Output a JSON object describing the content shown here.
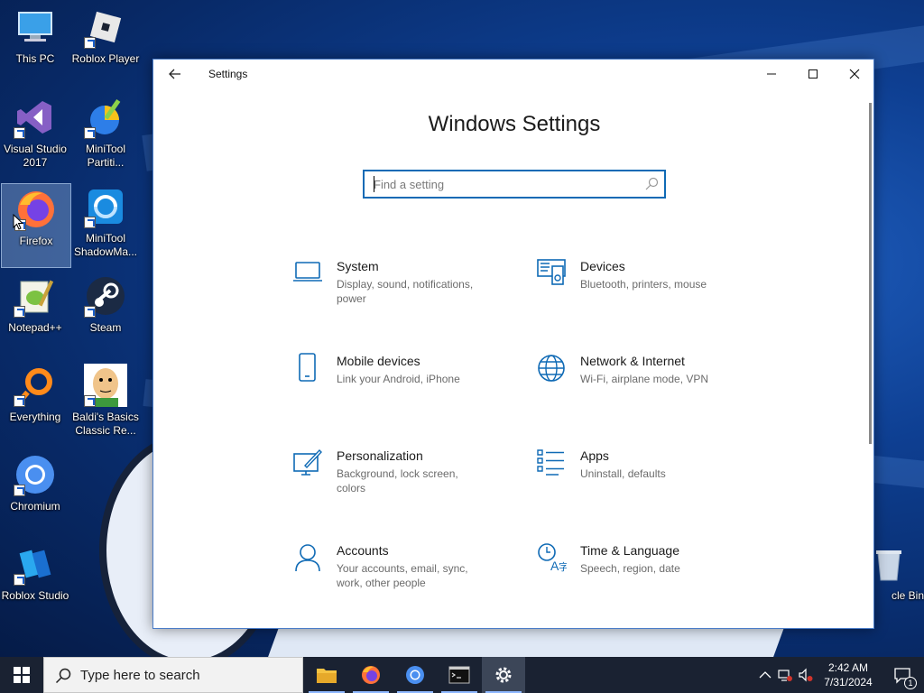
{
  "desktop": {
    "icons": [
      {
        "label": "This PC"
      },
      {
        "label": "Roblox Player"
      },
      {
        "label": "Visual Studio\n2017"
      },
      {
        "label": "MiniTool\nPartiti..."
      },
      {
        "label": "Firefox"
      },
      {
        "label": "MiniTool\nShadowMa..."
      },
      {
        "label": "Notepad++"
      },
      {
        "label": "Steam"
      },
      {
        "label": "Everything"
      },
      {
        "label": "Baldi's Basics\nClassic Re..."
      },
      {
        "label": "Chromium"
      },
      {
        "label": "Roblox Studio"
      },
      {
        "label": "cle Bin"
      }
    ]
  },
  "window": {
    "title": "Settings",
    "heading": "Windows Settings",
    "search_placeholder": "Find a setting",
    "tiles": [
      {
        "name": "System",
        "desc": "Display, sound, notifications, power",
        "icon": "laptop-icon"
      },
      {
        "name": "Devices",
        "desc": "Bluetooth, printers, mouse",
        "icon": "devices-icon"
      },
      {
        "name": "Mobile devices",
        "desc": "Link your Android, iPhone",
        "icon": "phone-icon"
      },
      {
        "name": "Network & Internet",
        "desc": "Wi-Fi, airplane mode, VPN",
        "icon": "globe-icon"
      },
      {
        "name": "Personalization",
        "desc": "Background, lock screen, colors",
        "icon": "brush-icon"
      },
      {
        "name": "Apps",
        "desc": "Uninstall, defaults",
        "icon": "apps-list-icon"
      },
      {
        "name": "Accounts",
        "desc": "Your accounts, email, sync, work, other people",
        "icon": "person-icon"
      },
      {
        "name": "Time & Language",
        "desc": "Speech, region, date",
        "icon": "time-language-icon"
      }
    ]
  },
  "taskbar": {
    "search_text": "Type here to search",
    "time": "2:42 AM",
    "date": "7/31/2024",
    "notification_count": "1"
  },
  "colors": {
    "accent": "#0f6ab5",
    "taskbar": "#1a2232"
  }
}
